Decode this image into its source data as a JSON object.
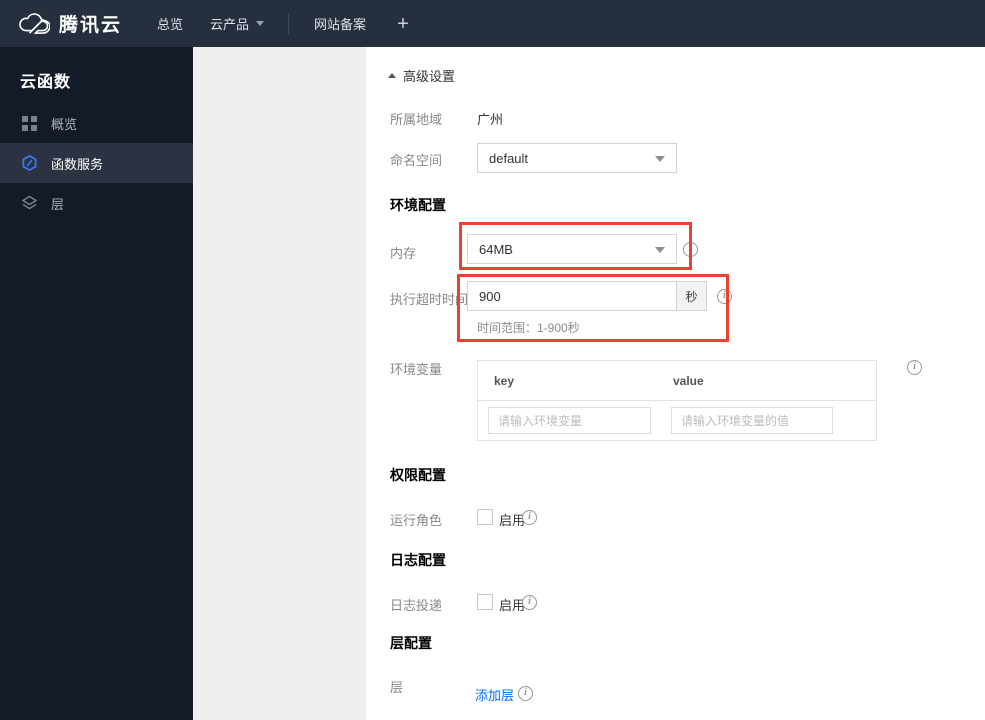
{
  "topnav": {
    "brand": "腾讯云",
    "overview": "总览",
    "products": "云产品",
    "icp": "网站备案",
    "plus": "+"
  },
  "sidebar": {
    "title": "云函数",
    "items": [
      {
        "label": "概览",
        "icon": "grid-icon",
        "active": false
      },
      {
        "label": "函数服务",
        "icon": "function-icon",
        "active": true
      },
      {
        "label": "层",
        "icon": "layers-icon",
        "active": false
      }
    ]
  },
  "main": {
    "advanced_toggle": "高级设置",
    "region": {
      "label": "所属地域",
      "value": "广州"
    },
    "namespace": {
      "label": "命名空间",
      "value": "default"
    },
    "section_env": "环境配置",
    "memory": {
      "label": "内存",
      "value": "64MB"
    },
    "timeout": {
      "label": "执行超时时间",
      "value": "900",
      "unit": "秒",
      "hint": "时间范围：1-900秒"
    },
    "env_vars": {
      "label": "环境变量",
      "key_header": "key",
      "value_header": "value",
      "key_placeholder": "请输入环境变量",
      "value_placeholder": "请输入环境变量的值"
    },
    "section_perm": "权限配置",
    "run_role": {
      "label": "运行角色",
      "checkbox_label": "启用",
      "checked": false
    },
    "section_log": "日志配置",
    "log_delivery": {
      "label": "日志投递",
      "checkbox_label": "启用",
      "checked": false
    },
    "section_layer": "层配置",
    "layer": {
      "label": "层",
      "add_link": "添加层"
    }
  },
  "colors": {
    "highlight_red": "#e8432e",
    "link_blue": "#006eff",
    "nav_bg": "#262f3e",
    "sidebar_bg": "#141b28",
    "active_item_bg": "#2b3342",
    "active_icon_blue": "#3a7afe"
  }
}
